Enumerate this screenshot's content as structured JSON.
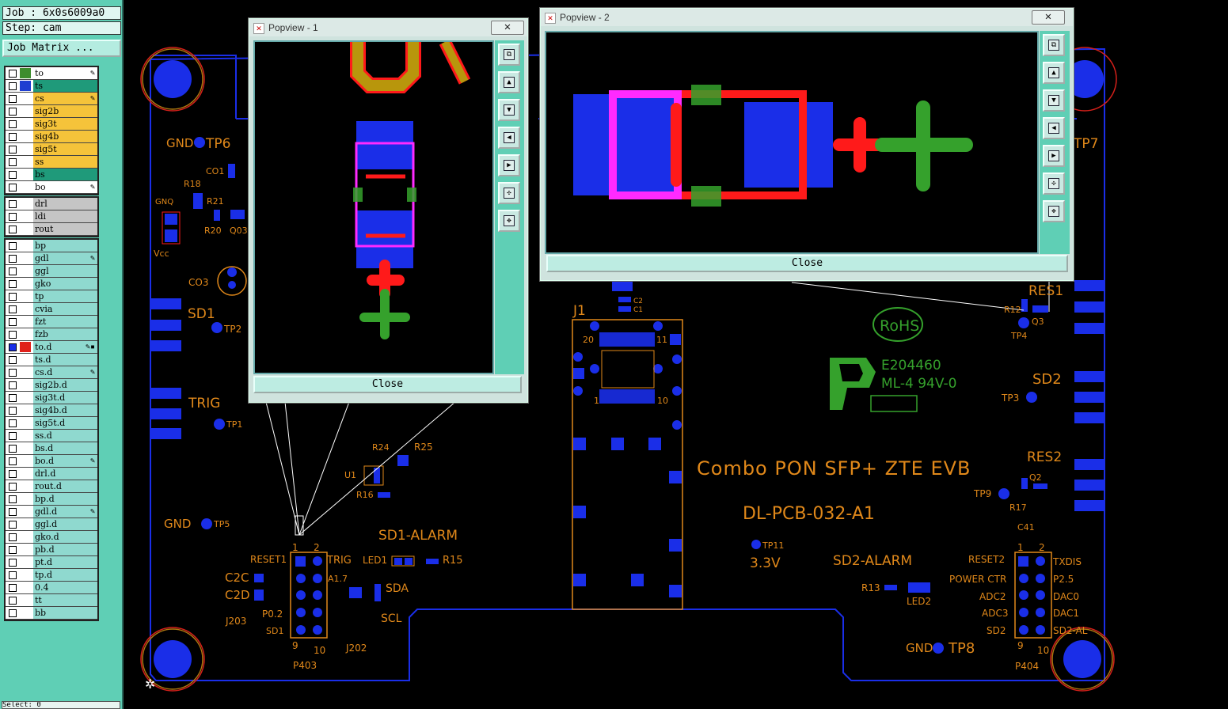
{
  "panel": {
    "job": "Job : 6x0s6009a0",
    "step": "Step: cam",
    "job_matrix_button": "Job Matrix ...",
    "bottom_text": "Select: 0"
  },
  "layers_group1": [
    {
      "name": "to",
      "swatch": "#3d8d2d",
      "bg": "#ffffff",
      "mark": "✎"
    },
    {
      "name": "ts",
      "swatch": "#1f3fd1",
      "bg": "#1f9a7a",
      "mark": ""
    },
    {
      "name": "cs",
      "swatch": "",
      "bg": "#f5c33a",
      "mark": "✎"
    },
    {
      "name": "sig2b",
      "swatch": "",
      "bg": "#f5c33a",
      "mark": ""
    },
    {
      "name": "sig3t",
      "swatch": "",
      "bg": "#f5c33a",
      "mark": ""
    },
    {
      "name": "sig4b",
      "swatch": "",
      "bg": "#f5c33a",
      "mark": ""
    },
    {
      "name": "sig5t",
      "swatch": "",
      "bg": "#f5c33a",
      "mark": ""
    },
    {
      "name": "ss",
      "swatch": "",
      "bg": "#f5c33a",
      "mark": ""
    },
    {
      "name": "bs",
      "swatch": "",
      "bg": "#1f9a7a",
      "mark": ""
    },
    {
      "name": "bo",
      "swatch": "",
      "bg": "#ffffff",
      "mark": "✎"
    }
  ],
  "layers_group2": [
    {
      "name": "drl",
      "swatch": "",
      "bg": "#c5c5c5",
      "mark": ""
    },
    {
      "name": "ldi",
      "swatch": "",
      "bg": "#c5c5c5",
      "mark": ""
    },
    {
      "name": "rout",
      "swatch": "",
      "bg": "#c5c5c5",
      "mark": ""
    }
  ],
  "layers_group3": [
    {
      "name": "bp",
      "swatch": "",
      "bg": "#8fd9cf",
      "mark": ""
    },
    {
      "name": "gdl",
      "swatch": "",
      "bg": "#8fd9cf",
      "mark": "✎"
    },
    {
      "name": "ggl",
      "swatch": "",
      "bg": "#8fd9cf",
      "mark": ""
    },
    {
      "name": "gko",
      "swatch": "",
      "bg": "#8fd9cf",
      "mark": ""
    },
    {
      "name": "tp",
      "swatch": "",
      "bg": "#8fd9cf",
      "mark": ""
    },
    {
      "name": "cvia",
      "swatch": "",
      "bg": "#8fd9cf",
      "mark": ""
    },
    {
      "name": "fzt",
      "swatch": "",
      "bg": "#8fd9cf",
      "mark": ""
    },
    {
      "name": "fzb",
      "swatch": "",
      "bg": "#8fd9cf",
      "mark": ""
    },
    {
      "name": "to.d",
      "swatch": "#e0201a",
      "bg": "#8fd9cf",
      "mark": "✎▪",
      "active": true
    },
    {
      "name": "ts.d",
      "swatch": "",
      "bg": "#8fd9cf",
      "mark": ""
    },
    {
      "name": "cs.d",
      "swatch": "",
      "bg": "#8fd9cf",
      "mark": "✎"
    },
    {
      "name": "sig2b.d",
      "swatch": "",
      "bg": "#8fd9cf",
      "mark": ""
    },
    {
      "name": "sig3t.d",
      "swatch": "",
      "bg": "#8fd9cf",
      "mark": ""
    },
    {
      "name": "sig4b.d",
      "swatch": "",
      "bg": "#8fd9cf",
      "mark": ""
    },
    {
      "name": "sig5t.d",
      "swatch": "",
      "bg": "#8fd9cf",
      "mark": ""
    },
    {
      "name": "ss.d",
      "swatch": "",
      "bg": "#8fd9cf",
      "mark": ""
    },
    {
      "name": "bs.d",
      "swatch": "",
      "bg": "#8fd9cf",
      "mark": ""
    },
    {
      "name": "bo.d",
      "swatch": "",
      "bg": "#8fd9cf",
      "mark": "✎"
    },
    {
      "name": "drl.d",
      "swatch": "",
      "bg": "#8fd9cf",
      "mark": ""
    },
    {
      "name": "rout.d",
      "swatch": "",
      "bg": "#8fd9cf",
      "mark": ""
    },
    {
      "name": "bp.d",
      "swatch": "",
      "bg": "#8fd9cf",
      "mark": ""
    },
    {
      "name": "gdl.d",
      "swatch": "",
      "bg": "#8fd9cf",
      "mark": "✎"
    },
    {
      "name": "ggl.d",
      "swatch": "",
      "bg": "#8fd9cf",
      "mark": ""
    },
    {
      "name": "gko.d",
      "swatch": "",
      "bg": "#8fd9cf",
      "mark": ""
    },
    {
      "name": "pb.d",
      "swatch": "",
      "bg": "#8fd9cf",
      "mark": ""
    },
    {
      "name": "pt.d",
      "swatch": "",
      "bg": "#8fd9cf",
      "mark": ""
    },
    {
      "name": "tp.d",
      "swatch": "",
      "bg": "#8fd9cf",
      "mark": ""
    },
    {
      "name": "0.4",
      "swatch": "",
      "bg": "#8fd9cf",
      "mark": ""
    },
    {
      "name": "tt",
      "swatch": "",
      "bg": "#8fd9cf",
      "mark": ""
    },
    {
      "name": "bb",
      "swatch": "",
      "bg": "#8fd9cf",
      "mark": ""
    }
  ],
  "popview1": {
    "title": "Popview - 1",
    "close_label": "Close",
    "close_x": "✕"
  },
  "popview2": {
    "title": "Popview - 2",
    "close_label": "Close",
    "close_x": "✕"
  },
  "popup_tools": [
    "zoom-home",
    "zoom-in",
    "zoom-out",
    "pan-left",
    "pan-right",
    "fit",
    "fit-all"
  ],
  "board": {
    "title_line1": "Combo PON SFP+ ZTE EVB",
    "title_line2": "DL-PCB-032-A1",
    "rohs": "RoHS",
    "ul_line1": "E204460",
    "ul_line2": "ML-4 94V-0",
    "labels": {
      "gnd_tp6": "GND",
      "tp6": "TP6",
      "tp7": "TP7",
      "co1": "CO1",
      "r18": "R18",
      "r21": "R21",
      "gnq": "GNQ",
      "r20": "R20",
      "q03": "Q03",
      "vcc": "Vcc",
      "co3": "CO3",
      "sd1": "SD1",
      "tp2": "TP2",
      "trig": "TRIG",
      "tp1": "TP1",
      "gnd_tp5": "GND",
      "tp5": "TP5",
      "r24": "R24",
      "r25": "R25",
      "u1": "U1",
      "r16": "R16",
      "sd1_alarm": "SD1-ALARM",
      "reset1": "RESET1",
      "trig2": "TRIG",
      "led1": "LED1",
      "r15": "R15",
      "a17": "A1.7",
      "c2c": "C2C",
      "c2d": "C2D",
      "sda": "SDA",
      "scl": "SCL",
      "p02": "P0.2",
      "sd1b": "SD1",
      "j203": "J203",
      "j202": "J202",
      "p403": "P403",
      "pin1": "1",
      "pin2": "2",
      "pin9": "9",
      "pin10": "10",
      "j1": "J1",
      "j1_20": "20",
      "j1_11": "11",
      "j1_1": "1",
      "j1_10": "10",
      "c2": "C2",
      "c1": "C1",
      "res1": "RES1",
      "r12": "R12",
      "q3": "Q3",
      "tp4": "TP4",
      "sd2": "SD2",
      "tp3": "TP3",
      "res2": "RES2",
      "tp9": "TP9",
      "q2": "Q2",
      "r17": "R17",
      "c41": "C41",
      "tp11": "TP11",
      "v33": "3.3V",
      "sd2_alarm": "SD2-ALARM",
      "r13": "R13",
      "led2": "LED2",
      "reset2": "RESET2",
      "power_ctr": "POWER CTR",
      "adc2": "ADC2",
      "adc3": "ADC3",
      "sd2b": "SD2",
      "txdis": "TXDIS",
      "p25": "P2.5",
      "dac0": "DAC0",
      "dac1": "DAC1",
      "sd2al": "SD2-AL",
      "gnd_tp8": "GND",
      "tp8": "TP8",
      "p404": "P404",
      "pin1b": "1",
      "pin2b": "2",
      "pin9b": "9",
      "pin10b": "10"
    }
  },
  "colors": {
    "copper": "#e0881a",
    "pad": "#1a2ee8",
    "outline": "#1a2ee8",
    "silk_green": "#35a12c",
    "red": "#ff1a1a",
    "magenta": "#ff2aff"
  }
}
